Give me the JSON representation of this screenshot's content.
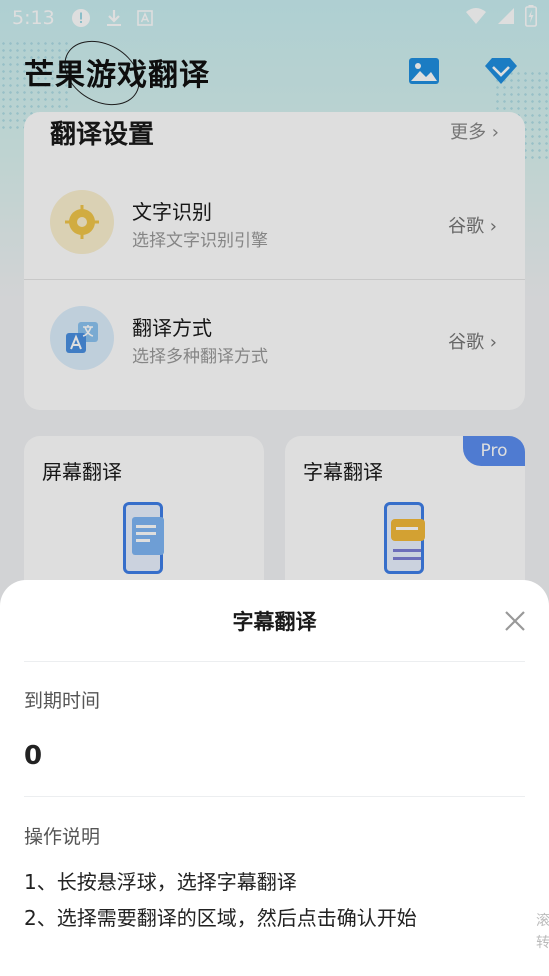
{
  "status_bar": {
    "time": "5:13"
  },
  "app": {
    "title": "芒果游戏翻译"
  },
  "settings": {
    "title": "翻译设置",
    "more": "更多 ›",
    "rows": [
      {
        "title": "文字识别",
        "subtitle": "选择文字识别引擎",
        "value": "谷歌 ›"
      },
      {
        "title": "翻译方式",
        "subtitle": "选择多种翻译方式",
        "value": "谷歌 ›"
      }
    ]
  },
  "features": [
    {
      "title": "屏幕翻译"
    },
    {
      "title": "字幕翻译",
      "badge": "Pro"
    }
  ],
  "sheet": {
    "title": "字幕翻译",
    "expire_label": "到期时间",
    "expire_value": "0",
    "instructions_label": "操作说明",
    "steps": [
      "1、长按悬浮球，选择字幕翻译",
      "2、选择需要翻译的区域，然后点击确认开始"
    ],
    "peek_text": "滚\n转"
  },
  "colors": {
    "accent": "#3f7fe8",
    "pro_badge": "#5b8ef0",
    "ocr_icon": "#f1c64a",
    "translate_icon": "#4a90e2"
  },
  "icons": {
    "image": "image-icon",
    "vip": "diamond-icon",
    "close": "close-icon"
  }
}
